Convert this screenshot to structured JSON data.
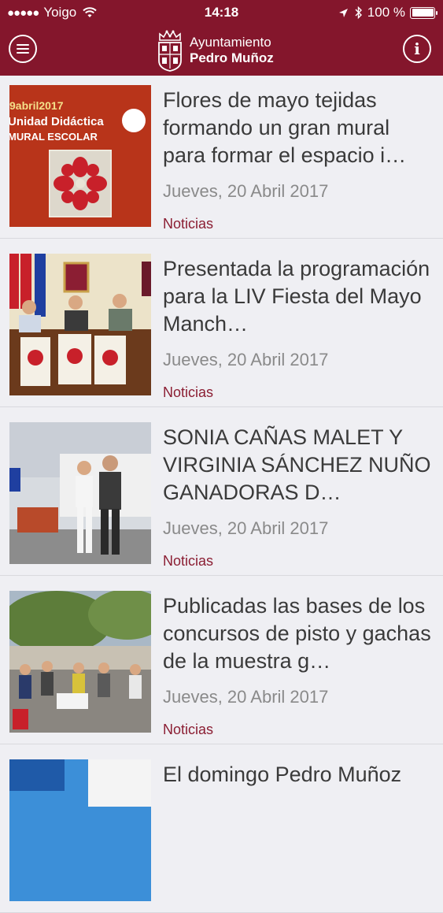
{
  "status_bar": {
    "carrier": "Yoigo",
    "time": "14:18",
    "battery": "100 %",
    "icons": [
      "signal-dots-icon",
      "wifi-icon",
      "location-arrow-icon",
      "bluetooth-icon",
      "battery-icon"
    ]
  },
  "header": {
    "brand_top": "Ayuntamiento",
    "brand_bottom": "Pedro Muñoz",
    "menu_icon": "hamburger-menu-icon",
    "info_icon": "info-icon",
    "crest_icon": "coat-of-arms-icon"
  },
  "colors": {
    "brand": "#84162c",
    "category": "#8b1e33",
    "background": "#efeff3"
  },
  "news": [
    {
      "title": "Flores de mayo tejidas formando un gran mural para formar el espacio i…",
      "date": "Jueves, 20 Abril 2017",
      "category": "Noticias",
      "thumb": {
        "line1": "9abril2017",
        "line2": "Unidad Didáctica",
        "line3": "MURAL ESCOLAR"
      }
    },
    {
      "title": "Presentada la programación para la LIV Fiesta del Mayo Manch…",
      "date": "Jueves, 20 Abril 2017",
      "category": "Noticias"
    },
    {
      "title": "SONIA CAÑAS MALET Y VIRGINIA SÁNCHEZ NUÑO GANADORAS D…",
      "date": "Jueves, 20 Abril 2017",
      "category": "Noticias"
    },
    {
      "title": "Publicadas las bases de los concursos de pisto y gachas de la muestra g…",
      "date": "Jueves, 20 Abril 2017",
      "category": "Noticias"
    },
    {
      "title": "El domingo Pedro Muñoz",
      "date": "",
      "category": ""
    }
  ]
}
